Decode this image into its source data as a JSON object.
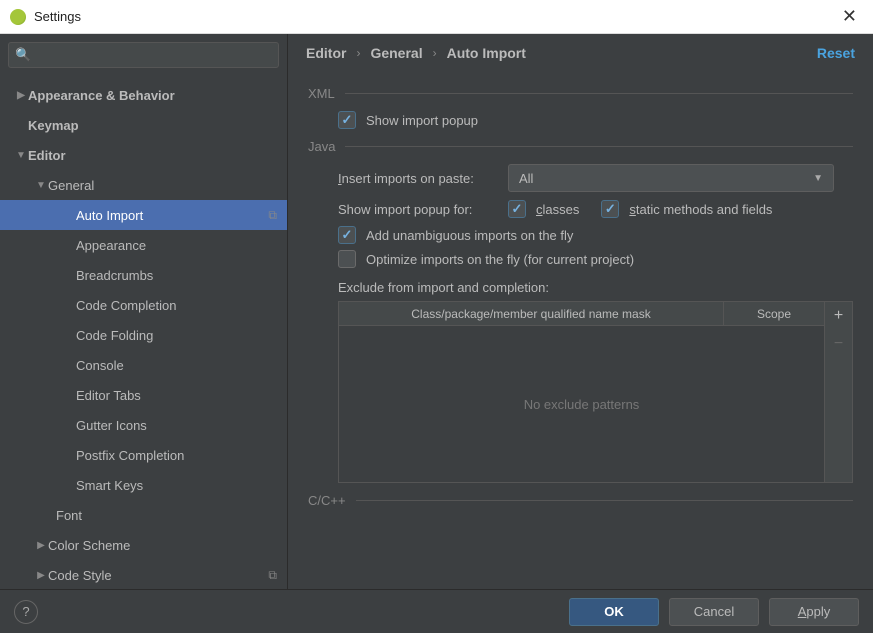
{
  "window": {
    "title": "Settings"
  },
  "search": {
    "placeholder": ""
  },
  "tree": {
    "appearance_behavior": "Appearance & Behavior",
    "keymap": "Keymap",
    "editor": "Editor",
    "general": "General",
    "auto_import": "Auto Import",
    "appearance": "Appearance",
    "breadcrumbs": "Breadcrumbs",
    "code_completion": "Code Completion",
    "code_folding": "Code Folding",
    "console": "Console",
    "editor_tabs": "Editor Tabs",
    "gutter_icons": "Gutter Icons",
    "postfix_completion": "Postfix Completion",
    "smart_keys": "Smart Keys",
    "font": "Font",
    "color_scheme": "Color Scheme",
    "code_style": "Code Style"
  },
  "breadcrumb": {
    "a": "Editor",
    "b": "General",
    "c": "Auto Import",
    "reset": "Reset"
  },
  "xml": {
    "heading": "XML",
    "show_popup": "Show import popup"
  },
  "java": {
    "heading": "Java",
    "insert_prefix": "I",
    "insert_rest": "nsert imports on paste:",
    "insert_value": "All",
    "show_popup_for": "Show import popup for:",
    "classes_u": "c",
    "classes_rest": "lasses",
    "static_u": "s",
    "static_rest": "tatic methods and fields",
    "add_unambiguous": "Add unambiguous imports on the fly",
    "optimize": "Optimize imports on the fly (for current project)",
    "exclude_label": "Exclude from import and completion:",
    "col_mask": "Class/package/member qualified name mask",
    "col_scope": "Scope",
    "empty": "No exclude patterns"
  },
  "cpp": {
    "heading": "C/C++"
  },
  "footer": {
    "ok": "OK",
    "cancel": "Cancel",
    "apply_u": "A",
    "apply_rest": "pply"
  }
}
